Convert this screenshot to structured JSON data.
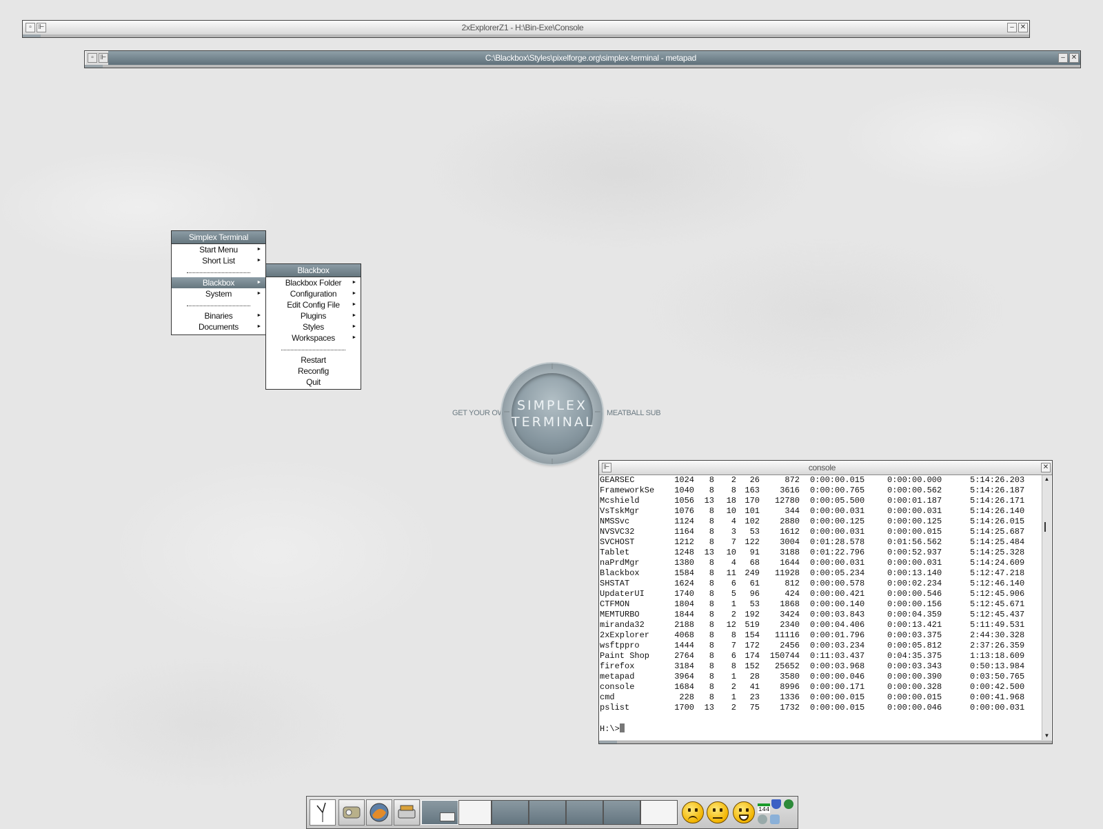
{
  "windows": {
    "explorer": {
      "title": "2xExplorerZ1 - H:\\Bin-Exe\\Console"
    },
    "metapad": {
      "title": "C:\\Blackbox\\Styles\\pixelforge.org\\simplex-terminal - metapad"
    },
    "console": {
      "title": "console"
    }
  },
  "root_menu": {
    "title": "Simplex Terminal",
    "items": [
      {
        "label": "Start Menu",
        "submenu": true
      },
      {
        "label": "Short List",
        "submenu": true
      },
      {
        "separator": true
      },
      {
        "label": "Blackbox",
        "submenu": true,
        "active": true
      },
      {
        "label": "System",
        "submenu": true
      },
      {
        "separator": true
      },
      {
        "label": "Binaries",
        "submenu": true
      },
      {
        "label": "Documents",
        "submenu": true
      }
    ]
  },
  "blackbox_menu": {
    "title": "Blackbox",
    "items": [
      {
        "label": "Blackbox Folder",
        "submenu": true
      },
      {
        "label": "Configuration",
        "submenu": true
      },
      {
        "label": "Edit Config File",
        "submenu": true
      },
      {
        "label": "Plugins",
        "submenu": true
      },
      {
        "label": "Styles",
        "submenu": true
      },
      {
        "label": "Workspaces",
        "submenu": true
      },
      {
        "separator": true
      },
      {
        "label": "Restart"
      },
      {
        "label": "Reconfig"
      },
      {
        "label": "Quit"
      }
    ]
  },
  "logo": {
    "left_text": "GET YOUR OWN",
    "right_text": "MEATBALL SUB",
    "line1": "SIMPLEX",
    "line2": "TERMINAL"
  },
  "console": {
    "rows": [
      [
        "GEARSEC",
        "1024",
        "8",
        "2",
        "26",
        "872",
        "0:00:00.015",
        "0:00:00.000",
        "5:14:26.203"
      ],
      [
        "FrameworkSe",
        "1040",
        "8",
        "8",
        "163",
        "3616",
        "0:00:00.765",
        "0:00:00.562",
        "5:14:26.187"
      ],
      [
        "Mcshield",
        "1056",
        "13",
        "18",
        "170",
        "12780",
        "0:00:05.500",
        "0:00:01.187",
        "5:14:26.171"
      ],
      [
        "VsTskMgr",
        "1076",
        "8",
        "10",
        "101",
        "344",
        "0:00:00.031",
        "0:00:00.031",
        "5:14:26.140"
      ],
      [
        "NMSSvc",
        "1124",
        "8",
        "4",
        "102",
        "2880",
        "0:00:00.125",
        "0:00:00.125",
        "5:14:26.015"
      ],
      [
        "NVSVC32",
        "1164",
        "8",
        "3",
        "53",
        "1612",
        "0:00:00.031",
        "0:00:00.015",
        "5:14:25.687"
      ],
      [
        "SVCHOST",
        "1212",
        "8",
        "7",
        "122",
        "3004",
        "0:01:28.578",
        "0:01:56.562",
        "5:14:25.484"
      ],
      [
        "Tablet",
        "1248",
        "13",
        "10",
        "91",
        "3188",
        "0:01:22.796",
        "0:00:52.937",
        "5:14:25.328"
      ],
      [
        "naPrdMgr",
        "1380",
        "8",
        "4",
        "68",
        "1644",
        "0:00:00.031",
        "0:00:00.031",
        "5:14:24.609"
      ],
      [
        "Blackbox",
        "1584",
        "8",
        "11",
        "249",
        "11928",
        "0:00:05.234",
        "0:00:13.140",
        "5:12:47.218"
      ],
      [
        "SHSTAT",
        "1624",
        "8",
        "6",
        "61",
        "812",
        "0:00:00.578",
        "0:00:02.234",
        "5:12:46.140"
      ],
      [
        "UpdaterUI",
        "1740",
        "8",
        "5",
        "96",
        "424",
        "0:00:00.421",
        "0:00:00.546",
        "5:12:45.906"
      ],
      [
        "CTFMON",
        "1804",
        "8",
        "1",
        "53",
        "1868",
        "0:00:00.140",
        "0:00:00.156",
        "5:12:45.671"
      ],
      [
        "MEMTURBO",
        "1844",
        "8",
        "2",
        "192",
        "3424",
        "0:00:03.843",
        "0:00:04.359",
        "5:12:45.437"
      ],
      [
        "miranda32",
        "2188",
        "8",
        "12",
        "519",
        "2340",
        "0:00:04.406",
        "0:00:13.421",
        "5:11:49.531"
      ],
      [
        "2xExplorer",
        "4068",
        "8",
        "8",
        "154",
        "11116",
        "0:00:01.796",
        "0:00:03.375",
        "2:44:30.328"
      ],
      [
        "wsftppro",
        "1444",
        "8",
        "7",
        "172",
        "2456",
        "0:00:03.234",
        "0:00:05.812",
        "2:37:26.359"
      ],
      [
        "Paint Shop",
        "2764",
        "8",
        "6",
        "174",
        "150744",
        "0:11:03.437",
        "0:04:35.375",
        "1:13:18.609"
      ],
      [
        "firefox",
        "3184",
        "8",
        "8",
        "152",
        "25652",
        "0:00:03.968",
        "0:00:03.343",
        "0:50:13.984"
      ],
      [
        "metapad",
        "3964",
        "8",
        "1",
        "28",
        "3580",
        "0:00:00.046",
        "0:00:00.390",
        "0:03:50.765"
      ],
      [
        "console",
        "1684",
        "8",
        "2",
        "41",
        "8996",
        "0:00:00.171",
        "0:00:00.328",
        "0:00:42.500"
      ],
      [
        "cmd",
        "228",
        "8",
        "1",
        "23",
        "1336",
        "0:00:00.015",
        "0:00:00.015",
        "0:00:41.968"
      ],
      [
        "pslist",
        "1700",
        "13",
        "2",
        "75",
        "1732",
        "0:00:00.015",
        "0:00:00.046",
        "0:00:00.031"
      ]
    ],
    "prompt": "H:\\>"
  },
  "taskbar": {
    "tray_count": "144"
  }
}
